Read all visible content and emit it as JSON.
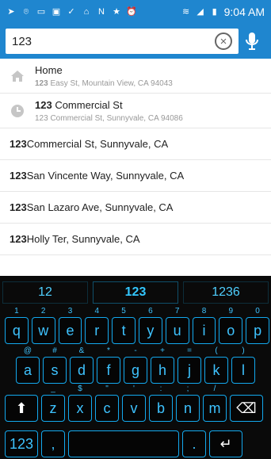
{
  "status_bar": {
    "time": "9:04 AM",
    "icons": [
      "location-arrow",
      "location-pin",
      "message",
      "save",
      "check",
      "pin",
      "n-app",
      "star",
      "alarm",
      "wifi",
      "signal",
      "battery"
    ]
  },
  "search": {
    "query": "123"
  },
  "suggestions": {
    "rich": [
      {
        "title": "Home",
        "subtitle_bold": "123",
        "subtitle_rest": " Easy St, Mountain View, CA 94043",
        "icon": "home-icon"
      },
      {
        "title_bold": "123",
        "title_rest": " Commercial St",
        "subtitle": "123 Commercial St, Sunnyvale, CA 94086",
        "icon": "history-icon"
      }
    ],
    "plain": [
      {
        "bold": "123",
        "rest": " Commercial St, Sunnyvale, CA"
      },
      {
        "bold": "123",
        "rest": " San Vincente Way, Sunnyvale, CA"
      },
      {
        "bold": "123",
        "rest": " San Lazaro Ave, Sunnyvale, CA"
      },
      {
        "bold": "123",
        "rest": " Holly Ter, Sunnyvale, CA"
      }
    ]
  },
  "keyboard": {
    "suggestions": [
      "12",
      "123",
      "1236"
    ],
    "row1": [
      {
        "k": "q",
        "h": "1"
      },
      {
        "k": "w",
        "h": "2"
      },
      {
        "k": "e",
        "h": "3"
      },
      {
        "k": "r",
        "h": "4"
      },
      {
        "k": "t",
        "h": "5"
      },
      {
        "k": "y",
        "h": "6"
      },
      {
        "k": "u",
        "h": "7"
      },
      {
        "k": "i",
        "h": "8"
      },
      {
        "k": "o",
        "h": "9"
      },
      {
        "k": "p",
        "h": "0"
      }
    ],
    "row2": [
      {
        "k": "a",
        "h": "@"
      },
      {
        "k": "s",
        "h": "#"
      },
      {
        "k": "d",
        "h": "&"
      },
      {
        "k": "f",
        "h": "*"
      },
      {
        "k": "g",
        "h": "-"
      },
      {
        "k": "h",
        "h": "+"
      },
      {
        "k": "j",
        "h": "="
      },
      {
        "k": "k",
        "h": "("
      },
      {
        "k": "l",
        "h": ")"
      }
    ],
    "row3": [
      {
        "k": "z",
        "h": "_"
      },
      {
        "k": "x",
        "h": "$"
      },
      {
        "k": "c",
        "h": "\""
      },
      {
        "k": "v",
        "h": "'"
      },
      {
        "k": "b",
        "h": ":"
      },
      {
        "k": "n",
        "h": ";"
      },
      {
        "k": "m",
        "h": "/"
      }
    ],
    "symbols_label": "123",
    "comma": ",",
    "period": "."
  }
}
